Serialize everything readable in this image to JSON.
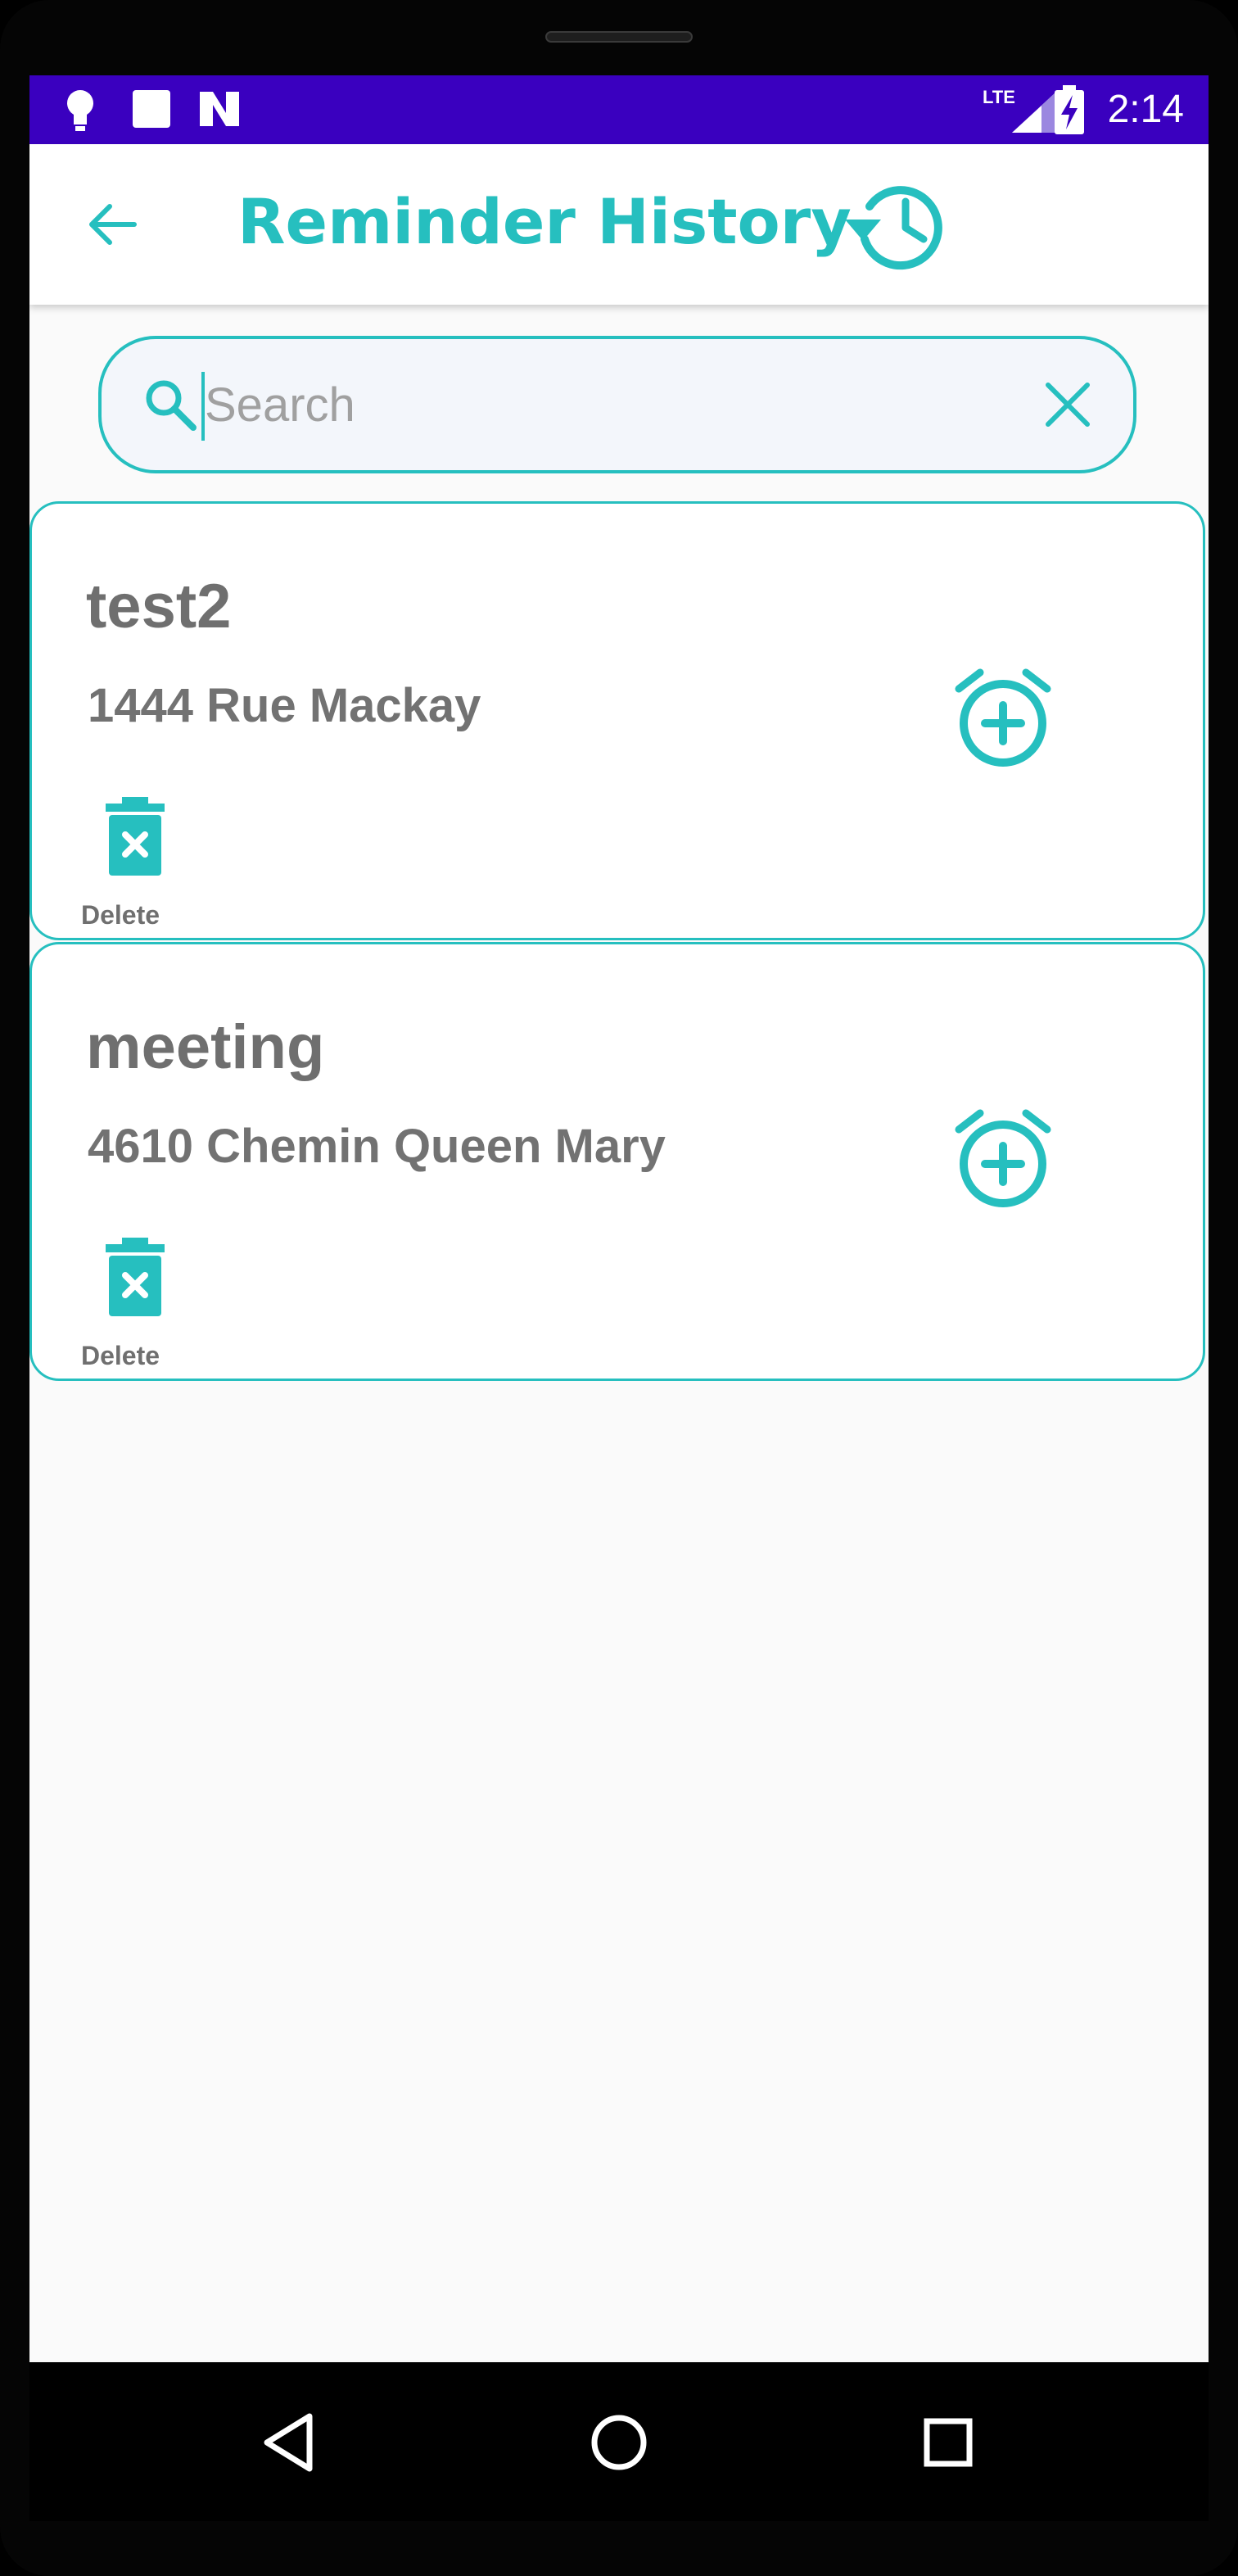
{
  "status_bar": {
    "time": "2:14",
    "network": "LTE"
  },
  "header": {
    "title": "Reminder History"
  },
  "search": {
    "placeholder": "Search",
    "value": ""
  },
  "reminders": [
    {
      "title": "test2",
      "address": "1444 Rue Mackay",
      "delete_label": "Delete"
    },
    {
      "title": "meeting",
      "address": "4610 Chemin Queen Mary",
      "delete_label": "Delete"
    }
  ],
  "colors": {
    "accent": "#26bfbf",
    "status_bar": "#3a00bf",
    "text": "#6f6f6f"
  },
  "icons": {
    "back": "arrow-back-icon",
    "history": "history-icon",
    "search": "search-icon",
    "clear": "close-icon",
    "alarm": "alarm-add-icon",
    "delete": "trash-icon",
    "nav_back": "triangle-back-icon",
    "nav_home": "circle-home-icon",
    "nav_recents": "square-recents-icon"
  }
}
